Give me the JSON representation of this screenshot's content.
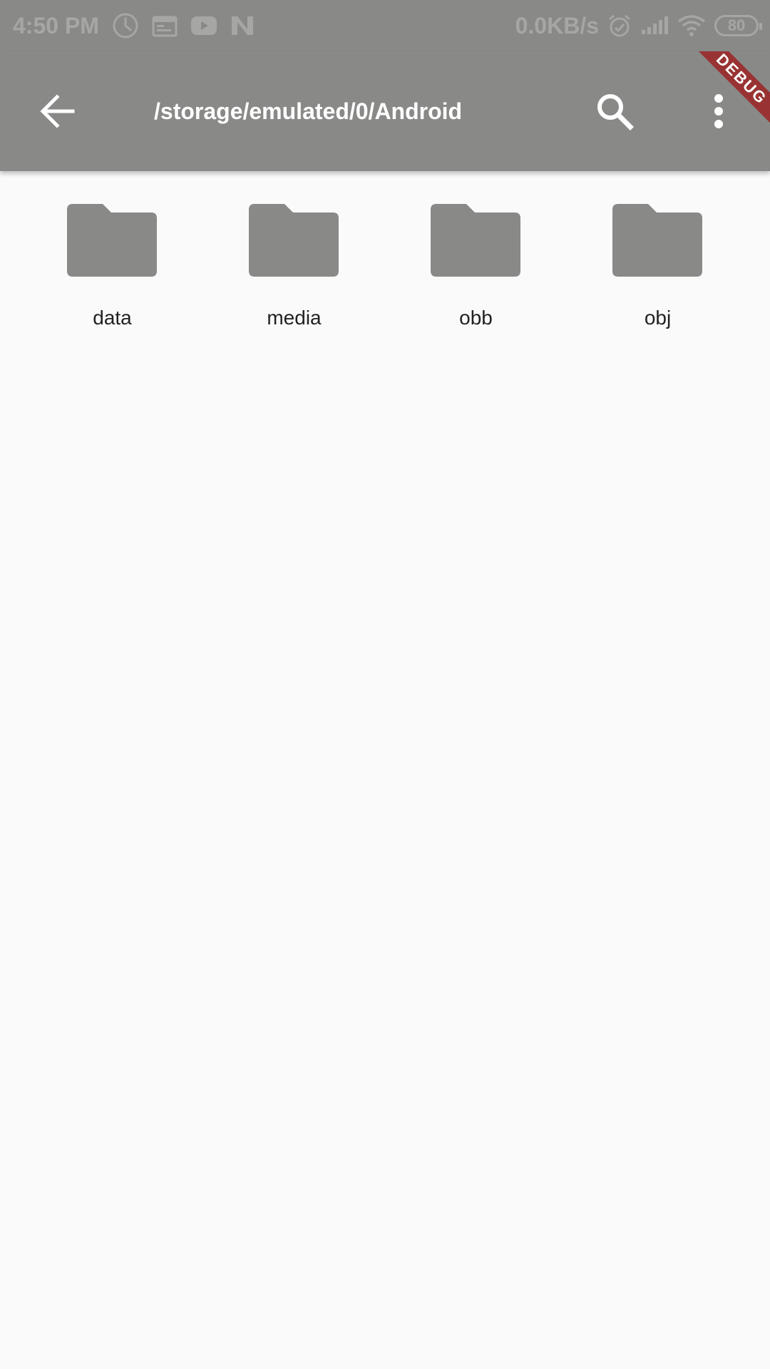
{
  "status_bar": {
    "time": "4:50 PM",
    "net_speed": "0.0KB/s",
    "battery": "80",
    "left_icons": [
      "clock-icon",
      "calendar-icon",
      "youtube-icon",
      "n-app-icon"
    ],
    "right_icons": [
      "alarm-icon",
      "signal-icon",
      "wifi-icon",
      "battery-icon"
    ]
  },
  "app_bar": {
    "title": "/storage/emulated/0/Android",
    "back_icon": "arrow-back-icon",
    "search_icon": "search-icon",
    "more_icon": "more-vert-icon"
  },
  "debug_banner": {
    "label": "DEBUG"
  },
  "folders": [
    {
      "name": "data",
      "icon": "folder-icon"
    },
    {
      "name": "media",
      "icon": "folder-icon"
    },
    {
      "name": "obb",
      "icon": "folder-icon"
    },
    {
      "name": "obj",
      "icon": "folder-icon"
    }
  ],
  "colors": {
    "app_bar": "#898a88",
    "background": "#fafafa",
    "folder": "#898a88",
    "debug_ribbon": "#993333",
    "text": "#222222"
  }
}
